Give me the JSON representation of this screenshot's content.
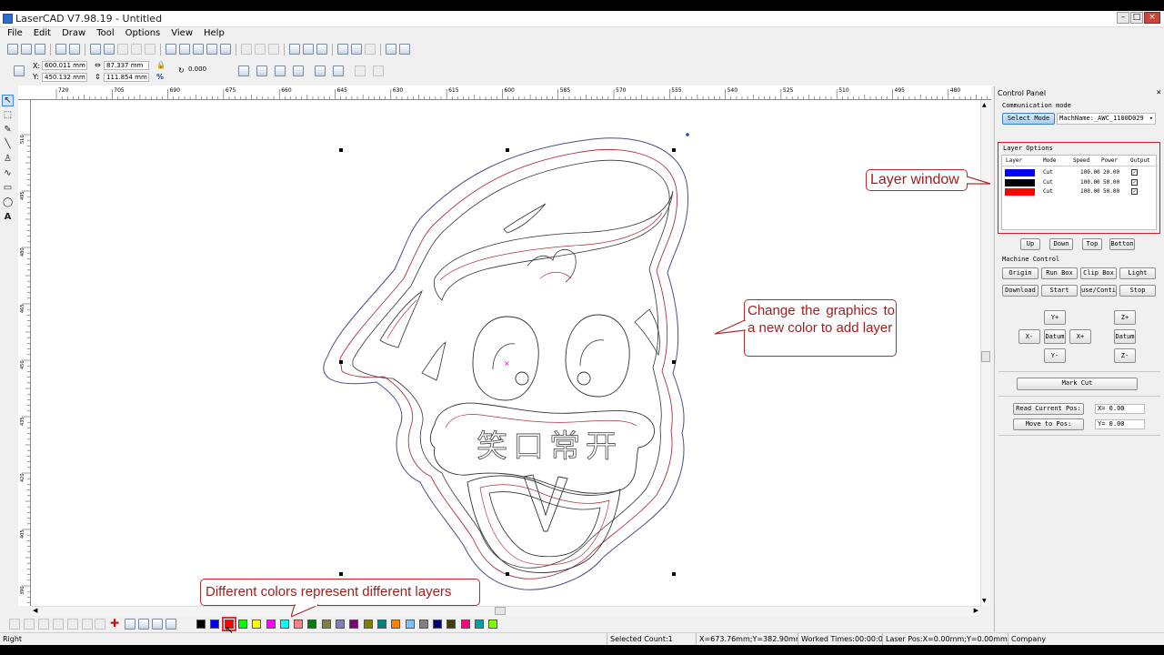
{
  "window": {
    "title": "LaserCAD V7.98.19 - Untitled"
  },
  "menu": [
    "File",
    "Edit",
    "Draw",
    "Tool",
    "Options",
    "View",
    "Help"
  ],
  "properties": {
    "x_label": "X:",
    "x_value": "600.011 mm",
    "y_label": "Y:",
    "y_value": "450.132 mm",
    "w_value": "87.337 mm",
    "h_value": "111.854 mm",
    "percent": "%",
    "angle": "0.000"
  },
  "ruler_top": [
    "720",
    "705",
    "690",
    "675",
    "660",
    "645",
    "630",
    "615",
    "600",
    "585",
    "570",
    "555",
    "540",
    "525",
    "510",
    "495",
    "480"
  ],
  "ruler_left": [
    "510",
    "495",
    "480",
    "465",
    "450",
    "435",
    "420",
    "405",
    "390"
  ],
  "canvas": {
    "text": "笑口常开"
  },
  "callouts": {
    "layer_window": "Layer window",
    "change_graphics": "Change the graphics to a new color to add layer",
    "colors": "Different colors represent different layers"
  },
  "panel": {
    "title": "Control Panel",
    "close": "×",
    "comm_label": "Communication mode",
    "select_mode": "Select Mode",
    "machine_name": "MachName:_AWC_1100D029",
    "layer_options": "Layer Options",
    "columns": [
      "Layer",
      "Mode",
      "Speed",
      "Power",
      "Output"
    ],
    "layers": [
      {
        "color": "#0000ff",
        "mode": "Cut",
        "speed": "100.00",
        "power": "20.00",
        "output": "✓"
      },
      {
        "color": "#000000",
        "mode": "Cut",
        "speed": "100.00",
        "power": "50.00",
        "output": "✓"
      },
      {
        "color": "#ff0000",
        "mode": "Cut",
        "speed": "100.00",
        "power": "50.00",
        "output": "✓"
      }
    ],
    "order_buttons": [
      "Up",
      "Down",
      "Top",
      "Botton"
    ],
    "machine_control": "Machine Control",
    "mc_row1": [
      "Origin",
      "Run Box",
      "Clip Box",
      "Light"
    ],
    "mc_row2": [
      "Download",
      "Start",
      "use/Contin",
      "Stop"
    ],
    "jog": {
      "y_plus": "Y+",
      "y_minus": "Y-",
      "x_minus": "X-",
      "x_plus": "X+",
      "datum": "Datum",
      "z_plus": "Z+",
      "z_minus": "Z-",
      "z_datum": "Datum"
    },
    "mark_cut": "Mark Cut",
    "read_pos": "Read Current Pos:",
    "move_pos": "Move to Pos:",
    "read_x": "X= 0.00",
    "move_y": "Y= 0.00"
  },
  "palette": [
    "#000000",
    "#0000ff",
    "#ff0000",
    "#00ff00",
    "#ffff00",
    "#ff00ff",
    "#00ffff",
    "#ff8080",
    "#008000",
    "#808040",
    "#8080c0",
    "#800080",
    "#808000",
    "#008080",
    "#ff8000",
    "#80c0ff",
    "#808080",
    "#000080",
    "#404000",
    "#ff0080",
    "#00a0a0",
    "#80ff00"
  ],
  "status": {
    "left": "Right",
    "selected": "Selected Count:1",
    "xy": "X=673.76mm;Y=382.90mm",
    "worked": "Worked Times:00:00:00",
    "laser": "Laser Pos:X=0.00mm;Y=0.00mm",
    "company": "Company"
  }
}
